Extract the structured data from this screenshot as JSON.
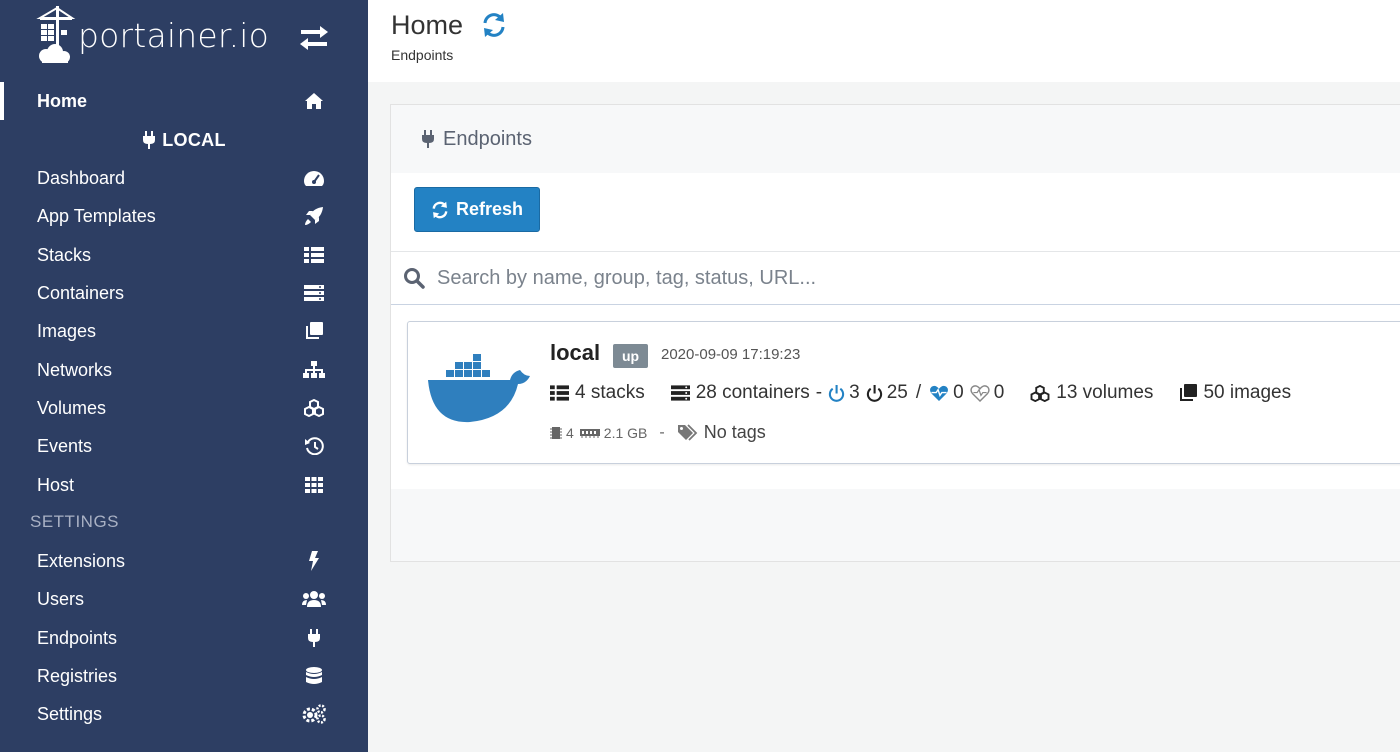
{
  "brand": {
    "name": "portainer.io"
  },
  "sidebar": {
    "home": {
      "label": "Home",
      "icon": "home-icon"
    },
    "endpoint_name": "LOCAL",
    "items": [
      {
        "label": "Dashboard",
        "icon": "tachometer-icon"
      },
      {
        "label": "App Templates",
        "icon": "rocket-icon"
      },
      {
        "label": "Stacks",
        "icon": "list-icon"
      },
      {
        "label": "Containers",
        "icon": "server-icon"
      },
      {
        "label": "Images",
        "icon": "clone-icon"
      },
      {
        "label": "Networks",
        "icon": "sitemap-icon"
      },
      {
        "label": "Volumes",
        "icon": "cubes-icon"
      },
      {
        "label": "Events",
        "icon": "history-icon"
      },
      {
        "label": "Host",
        "icon": "th-icon"
      }
    ],
    "settings_header": "SETTINGS",
    "settings_items": [
      {
        "label": "Extensions",
        "icon": "bolt-icon"
      },
      {
        "label": "Users",
        "icon": "users-icon"
      },
      {
        "label": "Endpoints",
        "icon": "plug-icon"
      },
      {
        "label": "Registries",
        "icon": "database-icon"
      },
      {
        "label": "Settings",
        "icon": "cogs-icon"
      }
    ]
  },
  "header": {
    "title": "Home",
    "breadcrumb": "Endpoints"
  },
  "widget": {
    "title": "Endpoints",
    "refresh_label": "Refresh",
    "search_placeholder": "Search by name, group, tag, status, URL..."
  },
  "endpoint": {
    "name": "local",
    "status": "up",
    "timestamp": "2020-09-09 17:19:23",
    "stacks": "4 stacks",
    "containers": "28 containers",
    "dash": "-",
    "running": "3",
    "stopped": "25",
    "slash": "/",
    "healthy": "0",
    "unhealthy": "0",
    "volumes": "13 volumes",
    "images": "50 images",
    "cpu": "4",
    "memory": "2.1 GB",
    "meta_dash": "-",
    "tags": "No tags"
  },
  "colors": {
    "sidebar_bg": "#2d3e63",
    "accent": "#2382c4",
    "status_badge": "#7d8a94",
    "docker_blue": "#2f7fbe"
  }
}
